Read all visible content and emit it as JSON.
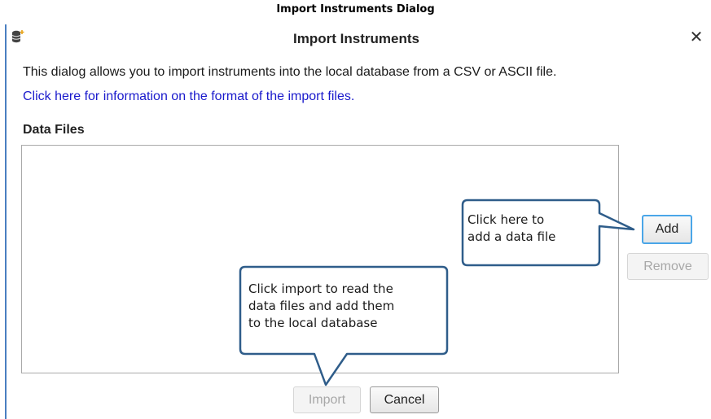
{
  "caption": "Import Instruments Dialog",
  "dialog": {
    "title": "Import Instruments",
    "close_glyph": "✕",
    "description": "This dialog allows you to import instruments into the local database from a CSV or ASCII file.",
    "format_link": "Click here for information on the format of the import files.",
    "data_files_label": "Data Files",
    "data_files": [],
    "buttons": {
      "add": "Add",
      "remove": "Remove",
      "import": "Import",
      "cancel": "Cancel"
    },
    "button_states": {
      "add": "focused",
      "remove": "disabled",
      "import": "disabled",
      "cancel": "enabled"
    }
  },
  "callouts": {
    "add": "Click here to\nadd a data file",
    "import": "Click import to read the\ndata files and add them\nto the local database"
  },
  "icons": {
    "title_icon": "database-add-icon",
    "close_icon": "close-icon"
  },
  "colors": {
    "dialog_border": "#4a7fc1",
    "link": "#1a1acc",
    "focus_ring": "#4aa6e8",
    "callout_border": "#2f5d8a"
  }
}
